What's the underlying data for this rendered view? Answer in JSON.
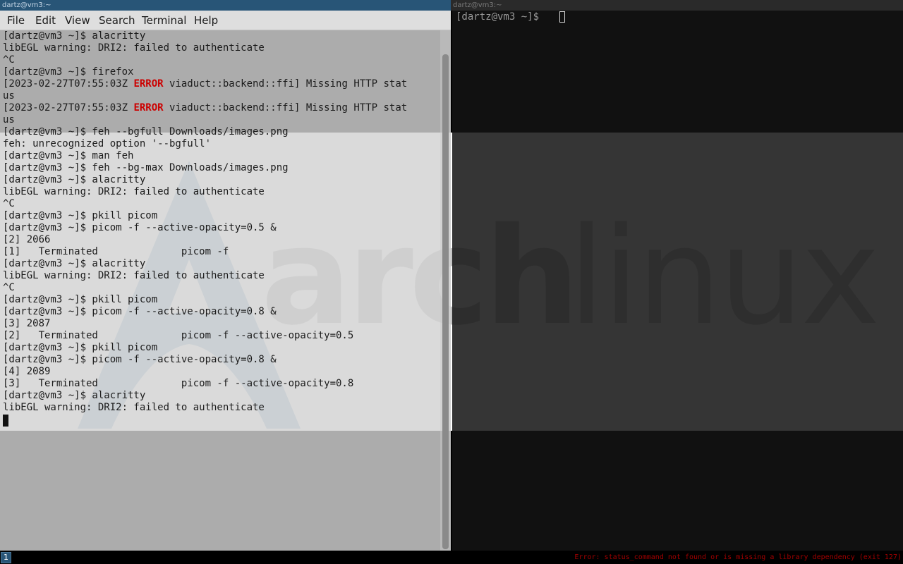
{
  "wallpaper": {
    "logo_word_arch": "arch",
    "logo_word_linux": "linux",
    "accent": "#1793d1"
  },
  "left_window": {
    "title": "dartz@vm3:~",
    "menu": [
      "File",
      "Edit",
      "View",
      "Search",
      "Terminal",
      "Help"
    ],
    "lines": [
      {
        "text": "[dartz@vm3 ~]$ alacritty"
      },
      {
        "text": "libEGL warning: DRI2: failed to authenticate"
      },
      {
        "text": "^C"
      },
      {
        "text": "[dartz@vm3 ~]$ firefox"
      },
      {
        "pre": "[2023-02-27T07:55:03Z ",
        "err": "ERROR",
        "post": " viaduct::backend::ffi] Missing HTTP stat"
      },
      {
        "text": "us"
      },
      {
        "pre": "[2023-02-27T07:55:03Z ",
        "err": "ERROR",
        "post": " viaduct::backend::ffi] Missing HTTP stat"
      },
      {
        "text": "us"
      },
      {
        "text": "[dartz@vm3 ~]$ feh --bgfull Downloads/images.png"
      },
      {
        "text": "feh: unrecognized option '--bgfull'"
      },
      {
        "text": "[dartz@vm3 ~]$ man feh"
      },
      {
        "text": "[dartz@vm3 ~]$ feh --bg-max Downloads/images.png"
      },
      {
        "text": "[dartz@vm3 ~]$ alacritty"
      },
      {
        "text": "libEGL warning: DRI2: failed to authenticate"
      },
      {
        "text": "^C"
      },
      {
        "text": "[dartz@vm3 ~]$ pkill picom"
      },
      {
        "text": "[dartz@vm3 ~]$ picom -f --active-opacity=0.5 &"
      },
      {
        "text": "[2] 2066"
      },
      {
        "text": "[1]   Terminated              picom -f"
      },
      {
        "text": "[dartz@vm3 ~]$ alacritty"
      },
      {
        "text": "libEGL warning: DRI2: failed to authenticate"
      },
      {
        "text": "^C"
      },
      {
        "text": "[dartz@vm3 ~]$ pkill picom"
      },
      {
        "text": "[dartz@vm3 ~]$ picom -f --active-opacity=0.8 &"
      },
      {
        "text": "[3] 2087"
      },
      {
        "text": "[2]   Terminated              picom -f --active-opacity=0.5"
      },
      {
        "text": "[dartz@vm3 ~]$ pkill picom"
      },
      {
        "text": "[dartz@vm3 ~]$ picom -f --active-opacity=0.8 &"
      },
      {
        "text": "[4] 2089"
      },
      {
        "text": "[3]   Terminated              picom -f --active-opacity=0.8"
      },
      {
        "text": "[dartz@vm3 ~]$ alacritty"
      },
      {
        "text": "libEGL warning: DRI2: failed to authenticate"
      }
    ],
    "error_color": "#cc0000"
  },
  "right_window": {
    "title": "dartz@vm3:~",
    "prompt": "[dartz@vm3 ~]$ "
  },
  "bar": {
    "workspace": "1",
    "status": "Error: status_command not found or is missing a library dependency (exit 127)"
  }
}
